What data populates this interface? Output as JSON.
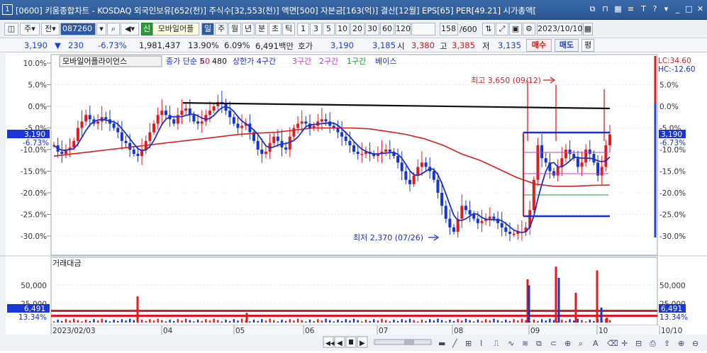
{
  "window": {
    "number": "1",
    "title": "[0600] 키움종합차트 - KOSDAQ 외국인보유[652(천)] 주식수[32,553(천)] 액면[500] 자본금[163(억)] 결산[12월] EPS[65] PER[49.21] 시가총액["
  },
  "toolbar": {
    "type_label": "주",
    "period_label": "전",
    "code_value": "087260",
    "new_badge": "신",
    "stock_name": "모바일어플",
    "day": "일",
    "week": "주",
    "month": "월",
    "year": "년",
    "minute": "분",
    "second": "초",
    "tick": "틱",
    "intervals": [
      "1",
      "3",
      "5",
      "10",
      "20",
      "30",
      "60",
      "120"
    ],
    "count_value": "158",
    "count_total": "/600",
    "date_value": "2023/10/10"
  },
  "pricebar": {
    "price": "3,190",
    "change": "230",
    "change_pct": "-6.73%",
    "volume": "1,981,437",
    "turnover_pct": "13.90%",
    "rate2": "6.09%",
    "amount": "6,491백만",
    "quote_label": "호가",
    "quote1": "3,190",
    "quote2": "3,185",
    "open_label": "시",
    "open": "3,380",
    "high_label": "고",
    "high": "3,385",
    "low_label": "저",
    "low": "3,135",
    "buy": "매수",
    "sell": "매도",
    "eval": "평"
  },
  "colors": {
    "up": "#e41a1c",
    "down": "#1534d6",
    "ma5": "#1a2fd0",
    "ma60": "#d81e1e",
    "ma480": "#111111",
    "bg_title": "#2b5593"
  },
  "chart": {
    "stock_tag": "모바일어플라이언스",
    "legend": {
      "close_label": "종가 단순 5",
      "ma60": "60",
      "ma480": "480",
      "upper": "상한가 4구간",
      "sec3": "3구간",
      "sec2": "2구간",
      "sec1": "1구간",
      "base": "베이스"
    },
    "y_ticks_left": [
      "10.0%",
      "5.0%",
      "0.0%",
      "-5.0%",
      "-10.0%",
      "-15.0%",
      "-20.0%",
      "-25.0%",
      "-30.0%"
    ],
    "y_ticks_right": [
      "5.0%",
      "0.0%",
      "-5.0%",
      "-10.0%",
      "-15.0%",
      "-20.0%",
      "-25.0%",
      "-30.0%"
    ],
    "lc": "LC:34.60",
    "hc": "HC:-12.60",
    "cur_price": "3,190",
    "cur_pct": "-6.73%",
    "high_annot": "최고 3,650 (09/12)",
    "low_annot": "최저 2,370 (07/26)",
    "vol_title": "거래대금",
    "vol_ticks": [
      "50,000",
      "25,000"
    ],
    "vol_cur": "6,491",
    "vol_pct": "13.34%",
    "months": [
      "2023/02/03",
      "04",
      "05",
      "06",
      "07",
      "08",
      "09",
      "10",
      "10/10"
    ]
  },
  "chart_data": {
    "type": "candlestick",
    "unit": "% change",
    "ylim": [
      -31.5,
      11
    ],
    "close": [
      -9,
      -10.5,
      -11,
      -10,
      -9.5,
      -8,
      -5,
      -3.5,
      -2,
      -3,
      -4,
      -3.5,
      -2.5,
      -3,
      -4,
      -5,
      -6,
      -8,
      -8.5,
      -10,
      -11,
      -11.5,
      -10,
      -8,
      -6,
      -4,
      -2,
      -1,
      -2,
      -3,
      -4,
      -2,
      -1,
      -0.5,
      -2,
      -3.5,
      -4,
      -3.5,
      -2,
      -1,
      0,
      1,
      0.5,
      -1,
      -2.5,
      -4,
      -5,
      -4.5,
      -4,
      -6,
      -8,
      -10,
      -11,
      -10.5,
      -8.5,
      -7,
      -8,
      -9.5,
      -10,
      -7,
      -5,
      -4,
      -3.5,
      -4,
      -5,
      -4.5,
      -3.5,
      -3,
      -3.5,
      -4.5,
      -5,
      -6,
      -7,
      -8,
      -9,
      -10.5,
      -11,
      -11,
      -10.5,
      -11,
      -11.5,
      -11,
      -10.5,
      -10,
      -10.5,
      -11.5,
      -13,
      -15,
      -17,
      -18,
      -16,
      -14,
      -13,
      -14,
      -15,
      -17,
      -20,
      -23,
      -26,
      -28,
      -29,
      -26,
      -23,
      -24,
      -25,
      -26,
      -27,
      -26.5,
      -26,
      -25.5,
      -26,
      -27,
      -28,
      -29,
      -29.5,
      -29.5,
      -29,
      -29,
      -28,
      -24,
      -17,
      -9,
      -12,
      -13,
      -15,
      -16,
      -14,
      -12,
      -10,
      -11,
      -12,
      -14,
      -13,
      -10,
      -11,
      -13,
      -16,
      -14,
      -9,
      -6.5
    ],
    "ma60": [
      -11.5,
      -11,
      -10.5,
      -10,
      -9.5,
      -9,
      -8.5,
      -8,
      -7.5,
      -7,
      -6.5,
      -6.2,
      -6,
      -5.5,
      -5,
      -5,
      -5,
      -5.2,
      -5.8,
      -6.5,
      -7.5,
      -9,
      -11,
      -12.5,
      -14.5,
      -16.5,
      -18,
      -18.5,
      -18.5,
      -18.3,
      -18.2
    ],
    "ma480": [
      0.8,
      -0.5
    ],
    "volume_bars": [
      {
        "x": "03/23",
        "value": 35000
      },
      {
        "x": "05/20",
        "value": 13000
      },
      {
        "x": "08/31",
        "value": 58000
      },
      {
        "x": "09/12",
        "value": 75000
      },
      {
        "x": "10/05",
        "value": 70000
      },
      {
        "x": "10/10",
        "value": 6491
      }
    ]
  }
}
